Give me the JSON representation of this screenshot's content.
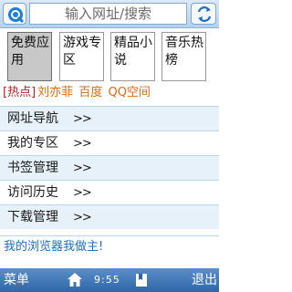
{
  "topbar": {
    "search_text": "输入网址/搜索"
  },
  "tiles": [
    {
      "label": "免费应用",
      "selected": true
    },
    {
      "label": "游戏专区",
      "selected": false
    },
    {
      "label": "精品小说",
      "selected": false
    },
    {
      "label": "音乐热榜",
      "selected": false
    }
  ],
  "hot": {
    "tag": "[热点]",
    "links": [
      "刘亦菲",
      "百度",
      "QQ空间"
    ]
  },
  "menu": [
    {
      "label": "网址导航",
      "arrow": ">>"
    },
    {
      "label": "我的专区",
      "arrow": ">>"
    },
    {
      "label": "书签管理",
      "arrow": ">>"
    },
    {
      "label": "访问历史",
      "arrow": ">>"
    },
    {
      "label": "下载管理",
      "arrow": ">>"
    }
  ],
  "slogan": "我的浏览器我做主!",
  "softbar": {
    "left": "菜单",
    "clock": "9:55",
    "right": "退出"
  },
  "colors": {
    "hot_tag": "#c0202a",
    "hot_link": "#e06a10",
    "slogan": "#1e6fc8",
    "softbar": "#3a72b2"
  },
  "icons": {
    "logo": "browser-logo-icon",
    "refresh": "refresh-icon",
    "home": "home-icon",
    "page": "bookmark-page-icon"
  }
}
